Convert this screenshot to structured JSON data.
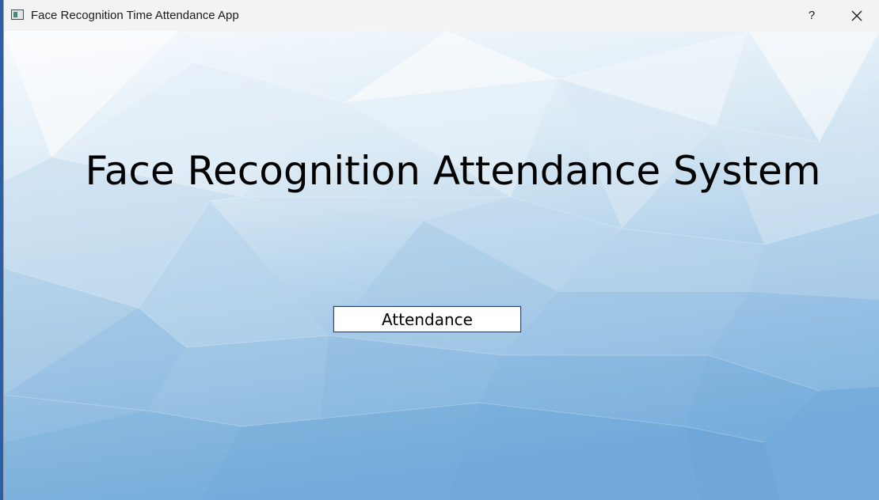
{
  "window": {
    "title": "Face Recognition Time Attendance App",
    "icon": "app-window-icon",
    "help_label": "?",
    "close_label": "✕"
  },
  "main": {
    "heading": "Face Recognition Attendance System",
    "attendance_button_label": "Attendance"
  },
  "colors": {
    "background_light": "#f5f9fd",
    "background_dark": "#6aa8d8",
    "button_border": "#0a4d9e"
  }
}
